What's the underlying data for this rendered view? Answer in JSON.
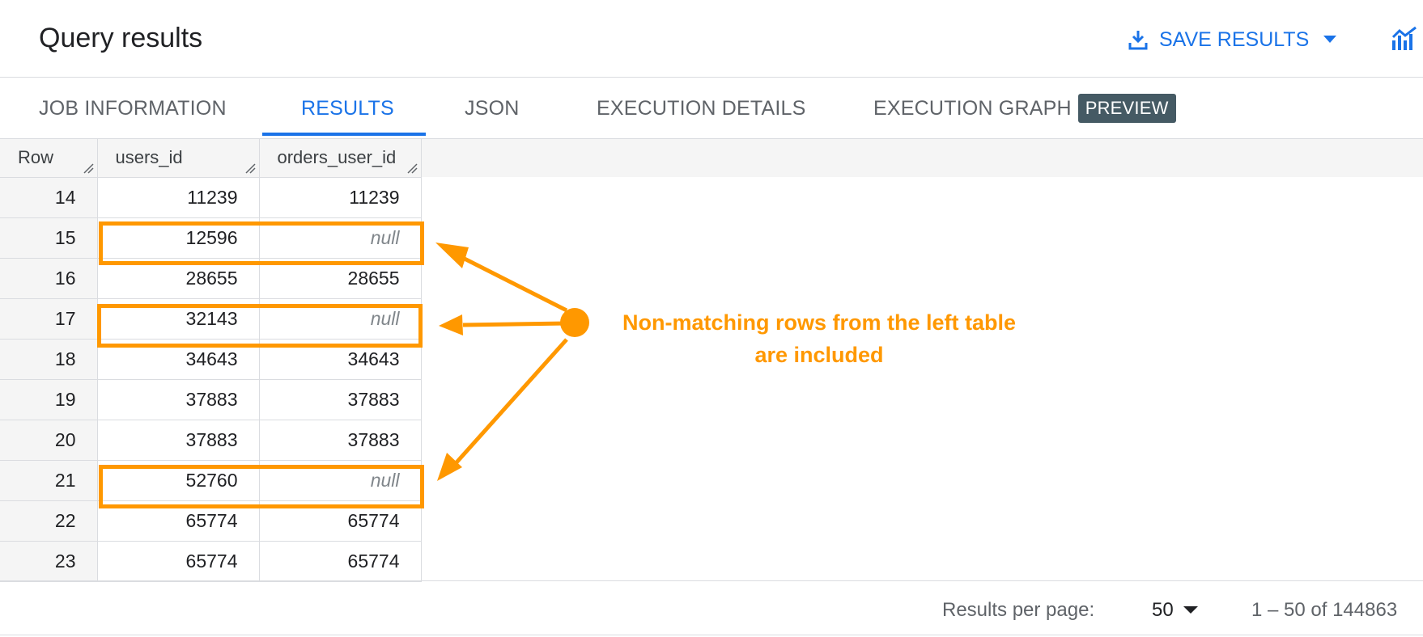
{
  "header": {
    "title": "Query results",
    "save_label": "SAVE RESULTS"
  },
  "tabs": [
    {
      "label": "JOB INFORMATION"
    },
    {
      "label": "RESULTS"
    },
    {
      "label": "JSON"
    },
    {
      "label": "EXECUTION DETAILS"
    },
    {
      "label": "EXECUTION GRAPH"
    }
  ],
  "preview_badge": "PREVIEW",
  "table": {
    "columns": [
      "Row",
      "users_id",
      "orders_user_id"
    ],
    "rows": [
      [
        "14",
        "11239",
        "11239"
      ],
      [
        "15",
        "12596",
        "null"
      ],
      [
        "16",
        "28655",
        "28655"
      ],
      [
        "17",
        "32143",
        "null"
      ],
      [
        "18",
        "34643",
        "34643"
      ],
      [
        "19",
        "37883",
        "37883"
      ],
      [
        "20",
        "37883",
        "37883"
      ],
      [
        "21",
        "52760",
        "null"
      ],
      [
        "22",
        "65774",
        "65774"
      ],
      [
        "23",
        "65774",
        "65774"
      ]
    ]
  },
  "annotation": {
    "line1": "Non-matching rows from the left table",
    "line2": "are included"
  },
  "footer": {
    "rpp_label": "Results per page:",
    "rpp_value": "50",
    "range": "1 – 50 of 144863"
  },
  "colors": {
    "accent": "#1a73e8",
    "highlight": "#ff9800"
  }
}
